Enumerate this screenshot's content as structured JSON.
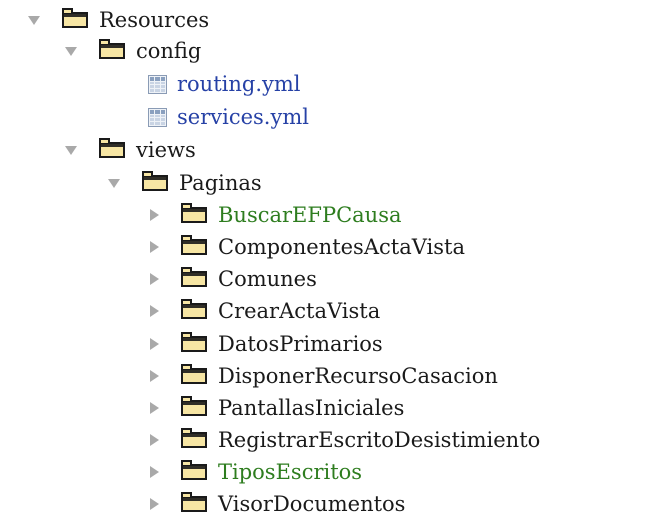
{
  "tree": {
    "resources": {
      "label": "Resources",
      "icon": "folder-open-icon"
    },
    "config": {
      "label": "config",
      "icon": "folder-open-icon"
    },
    "routing": {
      "label": "routing.yml",
      "icon": "yml-file-icon"
    },
    "services": {
      "label": "services.yml",
      "icon": "yml-file-icon"
    },
    "views": {
      "label": "views",
      "icon": "folder-open-icon"
    },
    "paginas": {
      "label": "Paginas",
      "icon": "folder-open-icon"
    },
    "children": [
      {
        "label": "BuscarEFPCausa",
        "status_color": "#2e7d1f"
      },
      {
        "label": "ComponentesActaVista",
        "status_color": "#1a1a1a"
      },
      {
        "label": "Comunes",
        "status_color": "#1a1a1a"
      },
      {
        "label": "CrearActaVista",
        "status_color": "#1a1a1a"
      },
      {
        "label": "DatosPrimarios",
        "status_color": "#1a1a1a"
      },
      {
        "label": "DisponerRecursoCasacion",
        "status_color": "#1a1a1a"
      },
      {
        "label": "PantallasIniciales",
        "status_color": "#1a1a1a"
      },
      {
        "label": "RegistrarEscritoDesistimiento",
        "status_color": "#1a1a1a"
      },
      {
        "label": "TiposEscritos",
        "status_color": "#2e7d1f"
      },
      {
        "label": "VisorDocumentos",
        "status_color": "#1a1a1a"
      }
    ]
  }
}
